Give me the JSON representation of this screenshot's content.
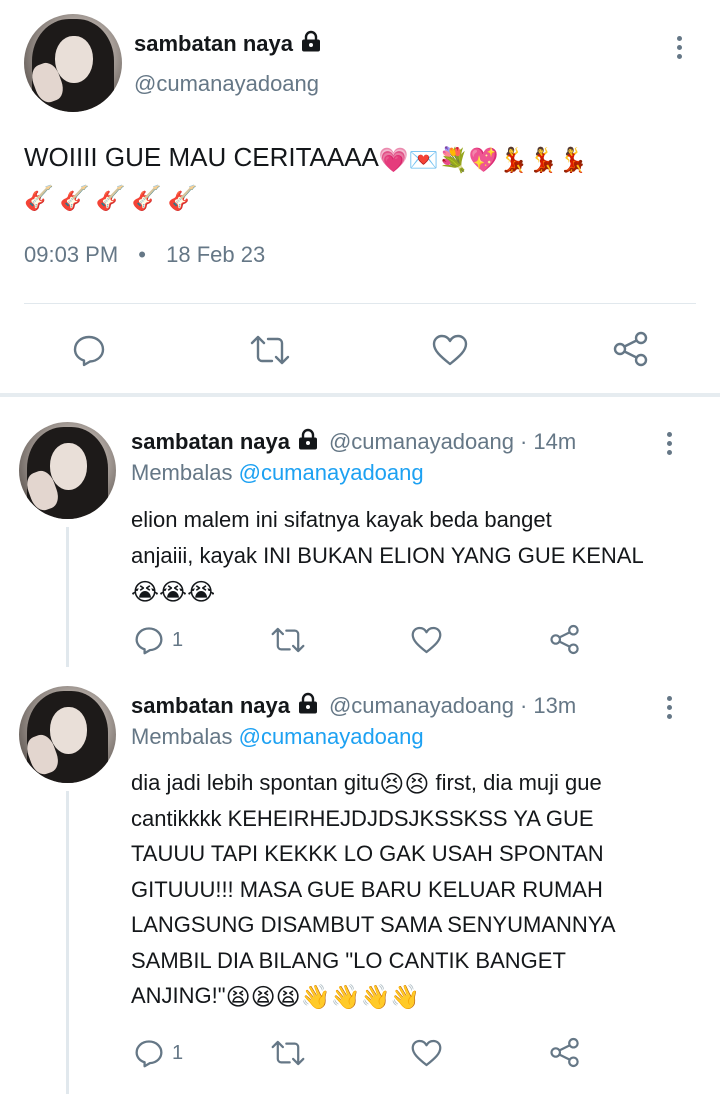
{
  "main_tweet": {
    "author_name": "sambatan naya",
    "author_handle": "@cumanayadoang",
    "text": "WOIIII GUE MAU CERITAAAA",
    "emojis_line1": [
      "💗",
      "💌",
      "💐",
      "💖",
      "💃",
      "💃",
      "💃"
    ],
    "emojis_line2": [
      "🎸",
      "🎸",
      "🎸",
      "🎸",
      "🎸"
    ],
    "time": "09:03 PM",
    "separator": "•",
    "date": "18 Feb 23",
    "icons": {
      "lock": "lock-icon",
      "more": "more-vertical-icon",
      "reply": "reply-icon",
      "retweet": "retweet-icon",
      "like": "heart-icon",
      "share": "share-icon"
    }
  },
  "replies": [
    {
      "author_name": "sambatan naya",
      "author_handle": "@cumanayadoang",
      "time_ago": "· 14m",
      "replying_prefix": "Membalas",
      "replying_to": "@cumanayadoang",
      "lines": [
        "elion malem ini sifatnya kayak beda banget",
        "anjaiii, kayak INI BUKAN ELION YANG GUE KENAL"
      ],
      "trailing_emojis": [
        "😭",
        "😭",
        "😭"
      ],
      "reply_count": "1"
    },
    {
      "author_name": "sambatan naya",
      "author_handle": "@cumanayadoang",
      "time_ago": "· 13m",
      "replying_prefix": "Membalas",
      "replying_to": "@cumanayadoang",
      "line1_before": "dia jadi lebih spontan gitu",
      "line1_emojis": [
        "😣",
        "😣"
      ],
      "line1_after": " first, dia muji gue",
      "lines": [
        "cantikkkk KEHEIRHEJDJDSJKSSKSS YA GUE",
        "TAUUU TAPI KEKKK LO GAK USAH SPONTAN",
        "GITUUU!!! MASA GUE BARU KELUAR RUMAH",
        "LANGSUNG DISAMBUT SAMA SENYUMANNYA",
        "SAMBIL DIA BILANG \"LO CANTIK BANGET"
      ],
      "last_line_text": "ANJING!\"",
      "last_line_emojis": [
        "😫",
        "😫",
        "😫",
        "👋",
        "👋",
        "👋",
        "👋"
      ],
      "reply_count": "1"
    }
  ],
  "colors": {
    "text": "#14171a",
    "secondary": "#657786",
    "link": "#1da1f2",
    "divider": "#e1e8ed"
  }
}
